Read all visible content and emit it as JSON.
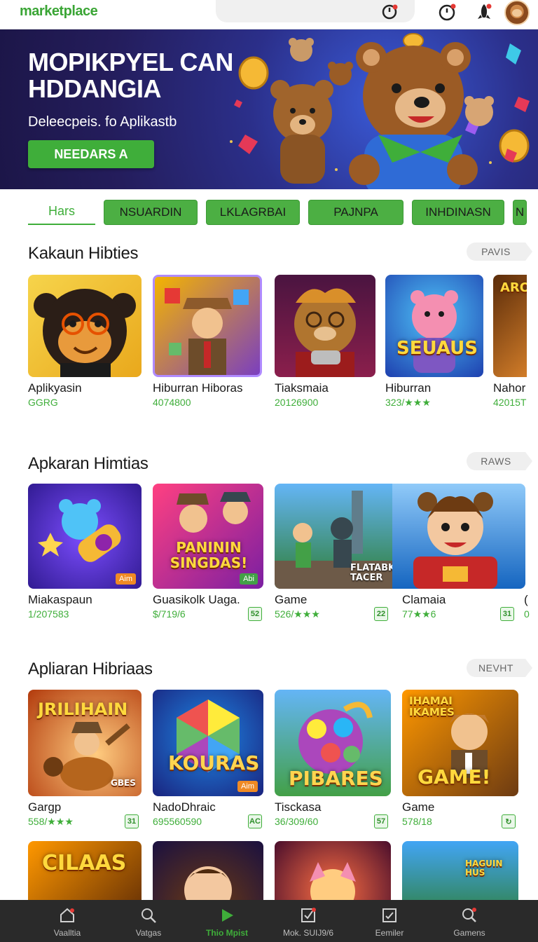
{
  "header": {
    "logo": "marketplace",
    "icons": [
      "timer-icon",
      "clock-icon",
      "rocket-icon",
      "bear-avatar"
    ]
  },
  "hero": {
    "title": "MOPIKPYEL CAN HDDANGIA",
    "subtitle": "Deleecpeis. fo Aplikastb",
    "button": "NEEDARS A"
  },
  "tabs": {
    "active": "Hars",
    "items": [
      "NSUARDIN",
      "LKLAGRBAI",
      "PAJNPA",
      "INHDINASN",
      "N"
    ]
  },
  "sections": [
    {
      "title": "Kakaun Hibties",
      "see_all": "PAVIS",
      "cards": [
        {
          "name": "Aplikyasin",
          "meta": "GGRG"
        },
        {
          "name": "Hiburran Hiboras",
          "meta": "4074800"
        },
        {
          "name": "Tiaksmaia",
          "meta": "20126900"
        },
        {
          "name": "Hiburran",
          "meta": "323/★★★"
        },
        {
          "name": "Nahor",
          "meta": "42015T"
        }
      ],
      "thumb_labels": [
        "",
        "",
        "",
        "SEUAUS",
        "ARO"
      ]
    },
    {
      "title": "Apkaran Himtias",
      "see_all": "RAWS",
      "cards": [
        {
          "name": "Miakaspaun",
          "meta": "1/207583",
          "tag": "Aim",
          "badge": ""
        },
        {
          "name": "Guasikolk Uaga.",
          "meta": "$/719/6",
          "tag": "Abi",
          "badge": "52"
        },
        {
          "name": "Game",
          "meta": "526/★★★",
          "badge": "22"
        },
        {
          "name": "Clamaia",
          "meta": "77★★6",
          "badge": "31"
        },
        {
          "name": "(",
          "meta": "0"
        }
      ],
      "thumb_labels": [
        "",
        "PANININ SINGDAS!",
        "FLATABK TACER",
        "",
        ""
      ]
    },
    {
      "title": "Apliaran Hibriaas",
      "see_all": "NEVHT",
      "cards": [
        {
          "name": "Gargp",
          "meta": "558/★★★",
          "badge": "31"
        },
        {
          "name": "NadoDhraic",
          "meta": "695560590",
          "badge": "AC"
        },
        {
          "name": "Tisckasa",
          "meta": "36/309/60",
          "badge": "57"
        },
        {
          "name": "Game",
          "meta": "578/18",
          "badge": "↻"
        }
      ],
      "thumb_labels": [
        "JRILIHAIN",
        "KOURAS",
        "PIBARES",
        "GAME!"
      ],
      "tags": [
        "",
        "Aim",
        "",
        ""
      ],
      "extra_labels": [
        "GBES",
        "IHAMAI IKAMES"
      ]
    }
  ],
  "row4_labels": [
    "CILAAS",
    "",
    "",
    "HAGUIN HUS"
  ],
  "bottom_nav": [
    {
      "label": "Vaalltia",
      "icon": "home-icon"
    },
    {
      "label": "Vatgas",
      "icon": "search-icon"
    },
    {
      "label": "Thio Mpist",
      "icon": "play-icon"
    },
    {
      "label": "Mok. SUIJ9/6",
      "icon": "checkbox-icon"
    },
    {
      "label": "Eemiler",
      "icon": "edit-box-icon"
    },
    {
      "label": "Gamens",
      "icon": "magnify-icon"
    }
  ],
  "colors": {
    "accent": "#3fae3a",
    "hero_bg": "#2b2f8a",
    "nav_bg": "#2a2a2a"
  }
}
